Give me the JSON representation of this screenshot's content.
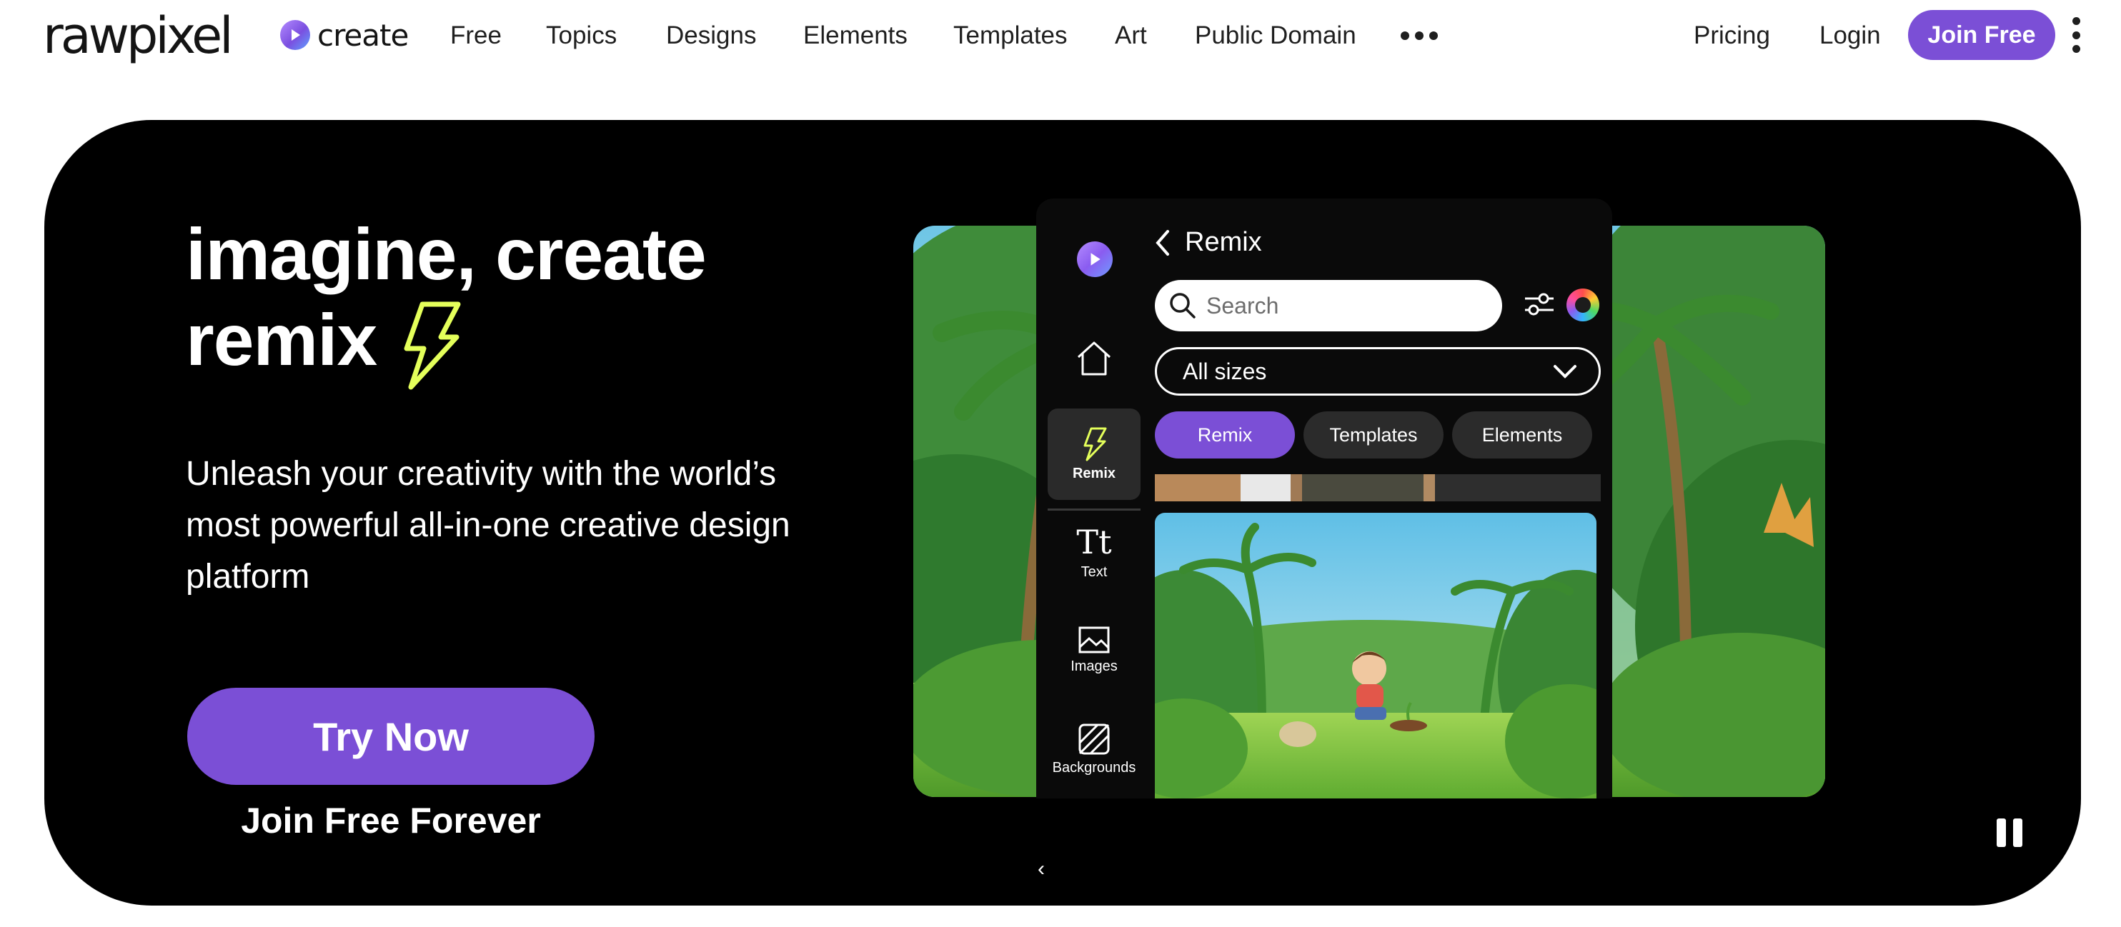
{
  "brand": {
    "logo": "rawpixel",
    "create": "create",
    "accent": "#7b4fd6"
  },
  "nav": {
    "links": [
      "Free",
      "Topics",
      "Designs",
      "Elements",
      "Templates",
      "Art",
      "Public Domain"
    ],
    "pricing": "Pricing",
    "login": "Login",
    "join": "Join Free"
  },
  "hero": {
    "headline_line1": "imagine, create",
    "headline_line2": "remix",
    "subtitle": "Unleash your creativity with the world’s most powerful all-in-one creative design platform",
    "cta": "Try Now",
    "cta_sub": "Join Free Forever"
  },
  "editor": {
    "title": "Remix",
    "search_placeholder": "Search",
    "size_select": "All sizes",
    "chips": [
      {
        "label": "Remix",
        "active": true
      },
      {
        "label": "Templates",
        "active": false
      },
      {
        "label": "Elements",
        "active": false
      }
    ],
    "rail": {
      "remix": "Remix",
      "text": "Text",
      "images": "Images",
      "backgrounds": "Backgrounds"
    }
  }
}
